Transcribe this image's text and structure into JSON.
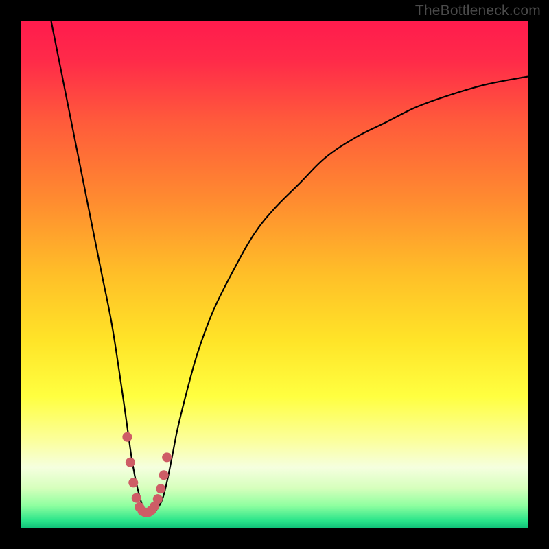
{
  "watermark": "TheBottleneck.com",
  "chart_data": {
    "type": "line",
    "title": "",
    "xlabel": "",
    "ylabel": "",
    "xlim": [
      0,
      100
    ],
    "ylim": [
      0,
      100
    ],
    "gradient_stops": [
      {
        "offset": 0.0,
        "color": "#ff1b4d"
      },
      {
        "offset": 0.08,
        "color": "#ff2b49"
      },
      {
        "offset": 0.2,
        "color": "#ff5b3b"
      },
      {
        "offset": 0.35,
        "color": "#ff8a30"
      },
      {
        "offset": 0.5,
        "color": "#ffbf28"
      },
      {
        "offset": 0.63,
        "color": "#ffe428"
      },
      {
        "offset": 0.74,
        "color": "#ffff40"
      },
      {
        "offset": 0.83,
        "color": "#fbffa0"
      },
      {
        "offset": 0.88,
        "color": "#f5ffdf"
      },
      {
        "offset": 0.92,
        "color": "#d7ffbd"
      },
      {
        "offset": 0.955,
        "color": "#8fffa0"
      },
      {
        "offset": 0.985,
        "color": "#29e48a"
      },
      {
        "offset": 1.0,
        "color": "#0fbf78"
      }
    ],
    "series": [
      {
        "name": "bottleneck-curve",
        "color": "#000000",
        "x": [
          6,
          8,
          10,
          12,
          14,
          16,
          18,
          20,
          21,
          22,
          23,
          24,
          25,
          26,
          27,
          28,
          29,
          30,
          31,
          33,
          35,
          38,
          42,
          46,
          50,
          55,
          60,
          66,
          72,
          78,
          85,
          92,
          100
        ],
        "y": [
          100,
          90,
          80,
          70,
          60,
          50,
          40,
          27,
          20,
          13,
          8,
          4.5,
          3,
          3,
          4,
          6,
          10,
          15,
          20,
          28,
          35,
          43,
          51,
          58,
          63,
          68,
          73,
          77,
          80,
          83,
          85.5,
          87.5,
          89
        ]
      },
      {
        "name": "valley-highlight",
        "color": "#ce5d66",
        "x": [
          21.0,
          21.6,
          22.2,
          22.8,
          23.4,
          24.0,
          24.6,
          25.2,
          25.8,
          26.4,
          27.0,
          27.6,
          28.2,
          28.8
        ],
        "y": [
          18,
          13,
          9,
          6,
          4.2,
          3.4,
          3.1,
          3.2,
          3.6,
          4.4,
          5.8,
          7.8,
          10.5,
          14
        ]
      }
    ],
    "series_styles": {
      "bottleneck-curve": {
        "stroke_width": 2.2,
        "dotted": false
      },
      "valley-highlight": {
        "stroke_width": 14,
        "dotted": true,
        "linecap": "round"
      }
    }
  }
}
